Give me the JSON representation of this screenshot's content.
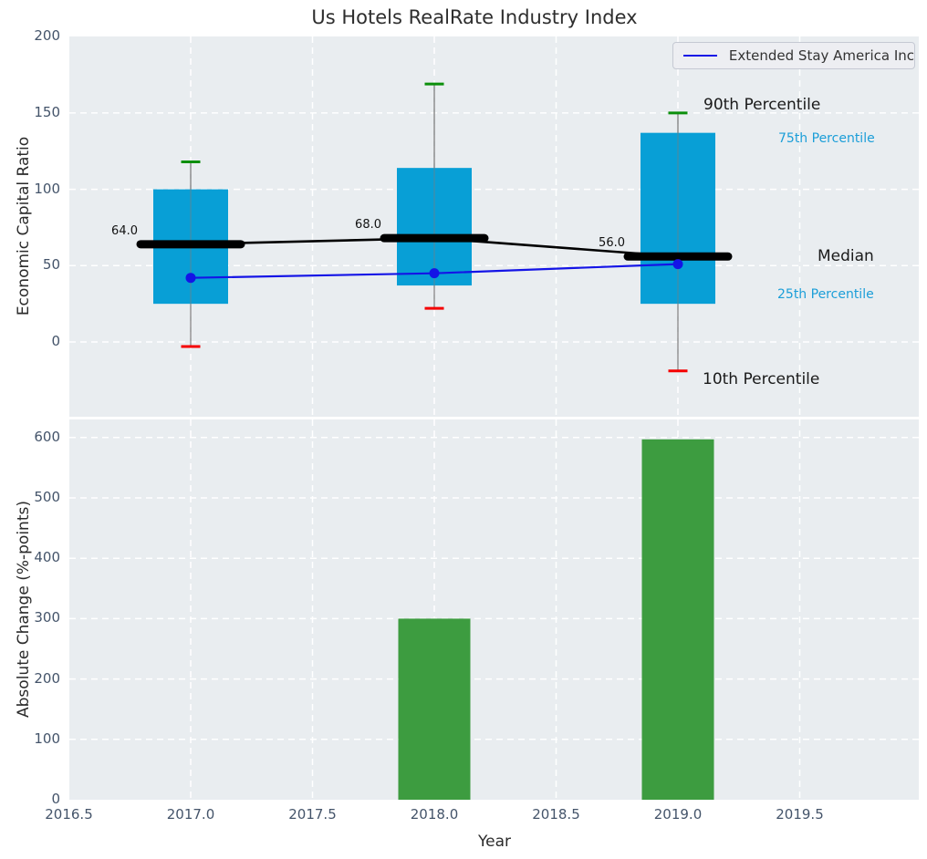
{
  "title": "Us Hotels RealRate Industry Index",
  "legend": {
    "label": "Extended Stay America Inc"
  },
  "annotations": {
    "p90": "90th Percentile",
    "p75": "75th Percentile",
    "median": "Median",
    "p25": "25th Percentile",
    "p10": "10th Percentile"
  },
  "colors": {
    "plot_bg": "#e9edf0",
    "grid": "#ffffff",
    "box_fill": "#089fd6",
    "whisker_stem": "#7c7c7c",
    "cap_high": "#0b8f0b",
    "cap_low": "#f50000",
    "median_line": "#000000",
    "company_line": "#1414e6",
    "bar_fill": "#3d9c40",
    "tick_label": "#44546a",
    "annotation_primary": "#1a1a1a",
    "annotation_secondary": "#1b9ed8"
  },
  "chart_data": [
    {
      "type": "box",
      "title": "Us Hotels RealRate Industry Index",
      "ylabel": "Economic Capital Ratio",
      "ylim": [
        -49,
        200
      ],
      "yticks": [
        0,
        50,
        100,
        150,
        200
      ],
      "grid": true,
      "legend_position": "upper right",
      "x": [
        2017,
        2018,
        2019
      ],
      "series": [
        {
          "name": "90th Percentile",
          "values": [
            118,
            169,
            150
          ]
        },
        {
          "name": "75th Percentile",
          "values": [
            100,
            114,
            137
          ]
        },
        {
          "name": "Median",
          "values": [
            64,
            68,
            56
          ]
        },
        {
          "name": "25th Percentile",
          "values": [
            25,
            37,
            25
          ]
        },
        {
          "name": "10th Percentile",
          "values": [
            -3,
            22,
            -19
          ]
        },
        {
          "name": "Extended Stay America Inc",
          "values": [
            42,
            45,
            51
          ]
        }
      ],
      "median_labels": [
        "64.0",
        "68.0",
        "56.0"
      ]
    },
    {
      "type": "bar",
      "ylabel": "Absolute Change (%-points)",
      "xlabel": "Year",
      "ylim": [
        0,
        630
      ],
      "yticks": [
        0,
        100,
        200,
        300,
        400,
        500,
        600
      ],
      "xticks": [
        2016.5,
        2017.0,
        2017.5,
        2018.0,
        2018.5,
        2019.0,
        2019.5
      ],
      "grid": true,
      "x": [
        2018,
        2019
      ],
      "values": [
        300,
        597
      ]
    }
  ]
}
